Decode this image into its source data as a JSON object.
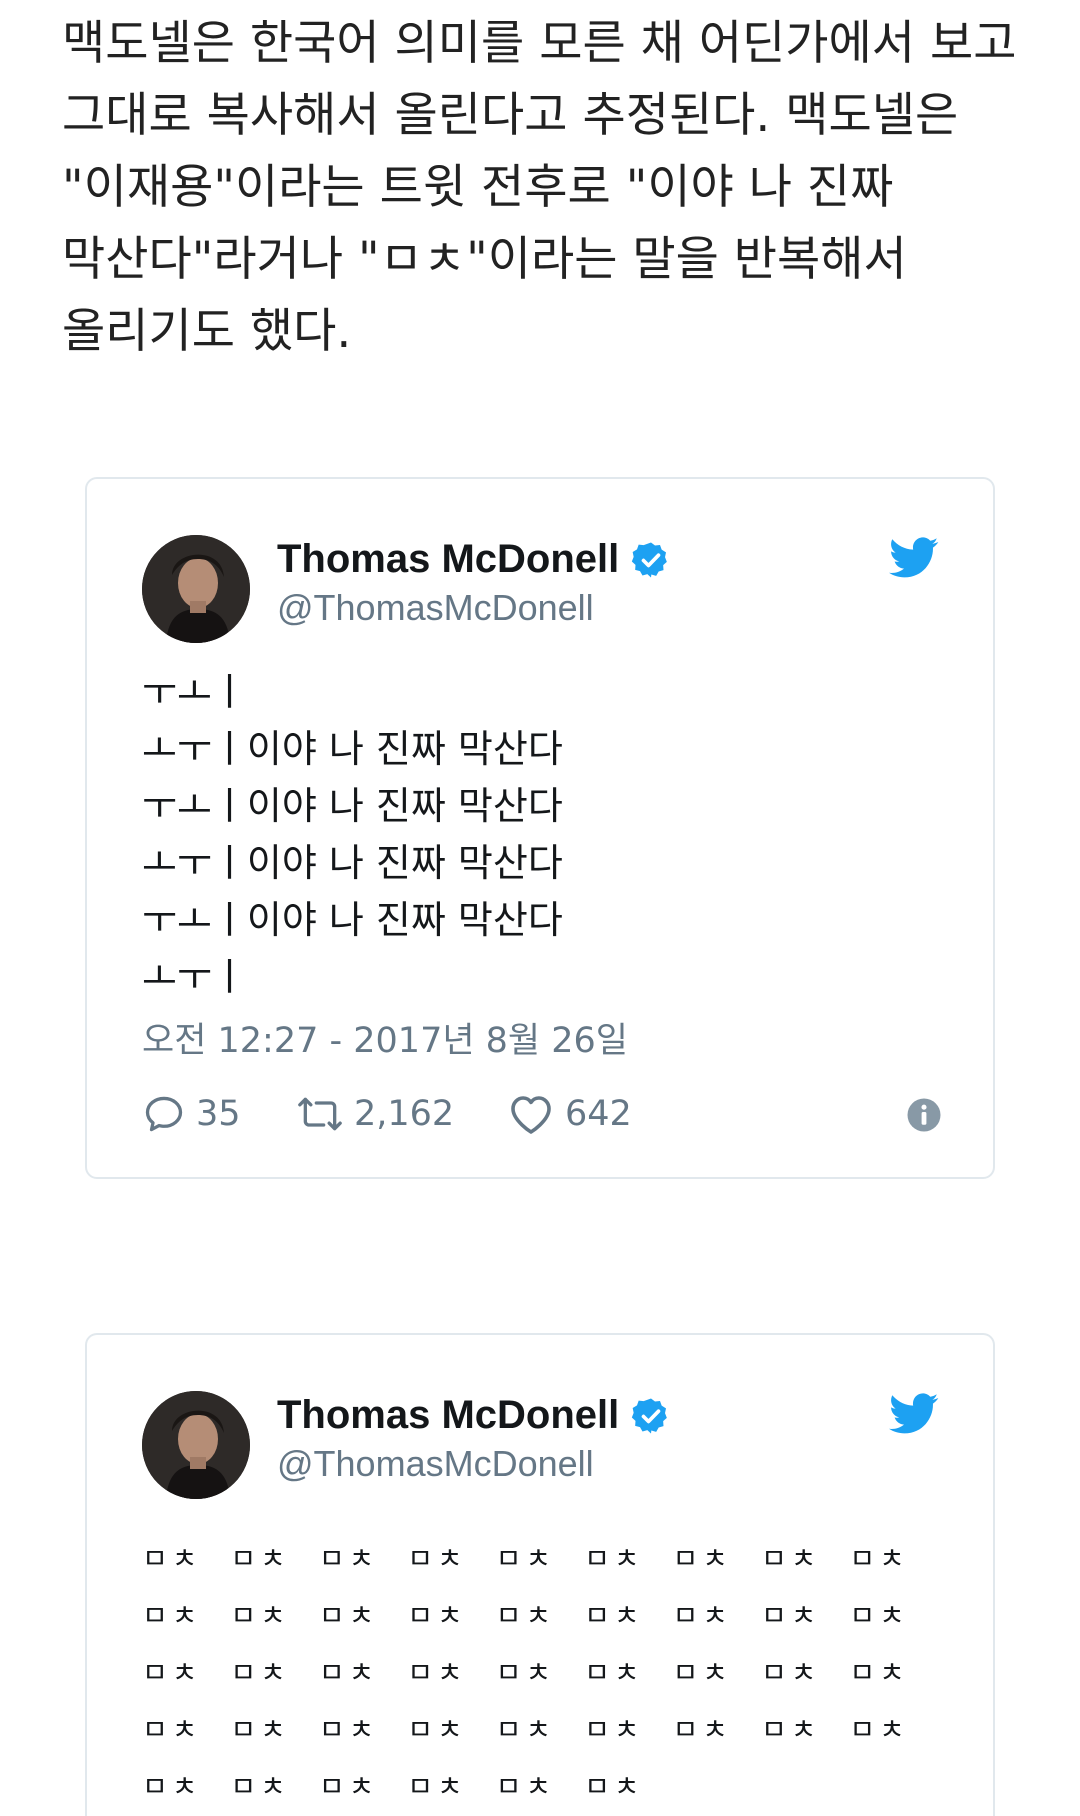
{
  "article": {
    "paragraph": "맥도넬은 한국어 의미를 모른 채 어딘가에서 보고 그대로 복사해서 올린다고 추정된다. 맥도넬은 \"이재용\"이라는 트윗 전후로 \"이야 나 진짜 막산다\"라거나 \"ㅁㅊ\"이라는 말을 반복해서 올리기도 했다."
  },
  "tweets": [
    {
      "author_name": "Thomas McDonell",
      "author_handle": "@ThomasMcDonell",
      "body": "ㅜㅗㅣ\nㅗㅜㅣ이야 나 진짜 막산다\nㅜㅗㅣ이야 나 진짜 막산다\nㅗㅜㅣ이야 나 진짜 막산다\nㅜㅗㅣ이야 나 진짜 막산다\nㅗㅜㅣ",
      "timestamp": "오전 12:27 - 2017년 8월 26일",
      "replies": "35",
      "retweets": "2,162",
      "likes": "642"
    },
    {
      "author_name": "Thomas McDonell",
      "author_handle": "@ThomasMcDonell",
      "body": "ㅁㅊ ㅁㅊ ㅁㅊ ㅁㅊ ㅁㅊ ㅁㅊ ㅁㅊ ㅁㅊ ㅁㅊ\nㅁㅊ ㅁㅊ ㅁㅊ ㅁㅊ ㅁㅊ ㅁㅊ ㅁㅊ ㅁㅊ ㅁㅊ\nㅁㅊ ㅁㅊ ㅁㅊ ㅁㅊ ㅁㅊ ㅁㅊ ㅁㅊ ㅁㅊ ㅁㅊ\nㅁㅊ ㅁㅊ ㅁㅊ ㅁㅊ ㅁㅊ ㅁㅊ ㅁㅊ ㅁㅊ ㅁㅊ\nㅁㅊ ㅁㅊ ㅁㅊ ㅁㅊ ㅁㅊ ㅁㅊ"
    }
  ],
  "icons": {
    "brand": "twitter-bird-icon",
    "verified": "verified-badge-icon",
    "reply": "speech-bubble-icon",
    "retweet": "retweet-arrows-icon",
    "like": "heart-icon",
    "info": "info-icon"
  },
  "colors": {
    "twitter_blue": "#1da1f2",
    "text_primary": "#14171a",
    "text_secondary": "#657786",
    "card_border": "#e1e8ed"
  }
}
